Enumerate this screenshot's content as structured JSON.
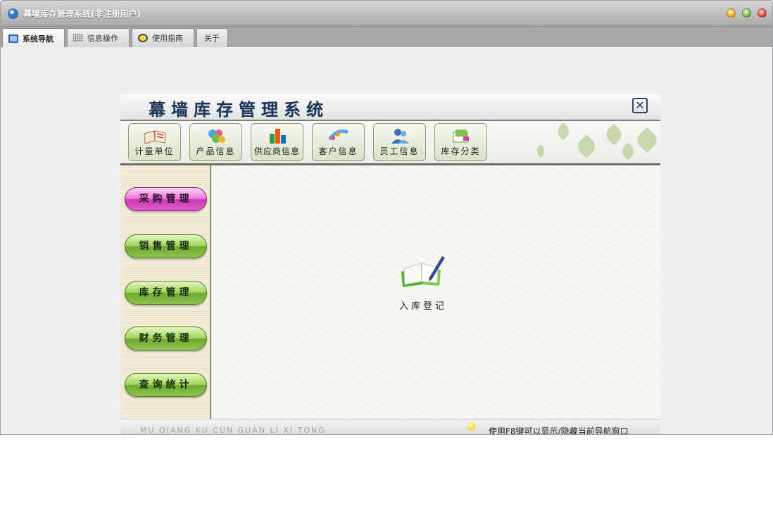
{
  "window": {
    "title": "幕墙库存管理系统(非注册用户)"
  },
  "tabs": [
    {
      "label": "系统导航",
      "icon": "monitor-icon",
      "active": true
    },
    {
      "label": "信息操作",
      "icon": "grid-icon",
      "active": false
    },
    {
      "label": "使用指南",
      "icon": "help-icon",
      "active": false
    },
    {
      "label": "关于",
      "icon": "",
      "active": false
    }
  ],
  "panel": {
    "title": "幕墙库存管理系统",
    "close_symbol": "✕"
  },
  "toolbar": {
    "buttons": [
      {
        "label": "计量单位",
        "icon": "book-icon"
      },
      {
        "label": "产品信息",
        "icon": "product-icon"
      },
      {
        "label": "供应商信息",
        "icon": "supplier-icon"
      },
      {
        "label": "客户信息",
        "icon": "customer-icon"
      },
      {
        "label": "员工信息",
        "icon": "employee-icon"
      },
      {
        "label": "库存分类",
        "icon": "category-icon"
      }
    ]
  },
  "sidebar": {
    "items": [
      {
        "label": "采购管理",
        "active": true
      },
      {
        "label": "销售管理",
        "active": false
      },
      {
        "label": "库存管理",
        "active": false
      },
      {
        "label": "财务管理",
        "active": false
      },
      {
        "label": "查询统计",
        "active": false
      }
    ]
  },
  "main": {
    "feature_label": "入库登记",
    "feature_icon": "book-pen-icon"
  },
  "footer": {
    "pinyin": "MU QIANG KU CUN  GUAN LI XI TONG",
    "hint": "使用F8键可以显示/隐藏当前导航窗口"
  },
  "colors": {
    "active_side_button": "#e15ccb",
    "side_button": "#8cc44e",
    "title_text": "#1d3557"
  }
}
